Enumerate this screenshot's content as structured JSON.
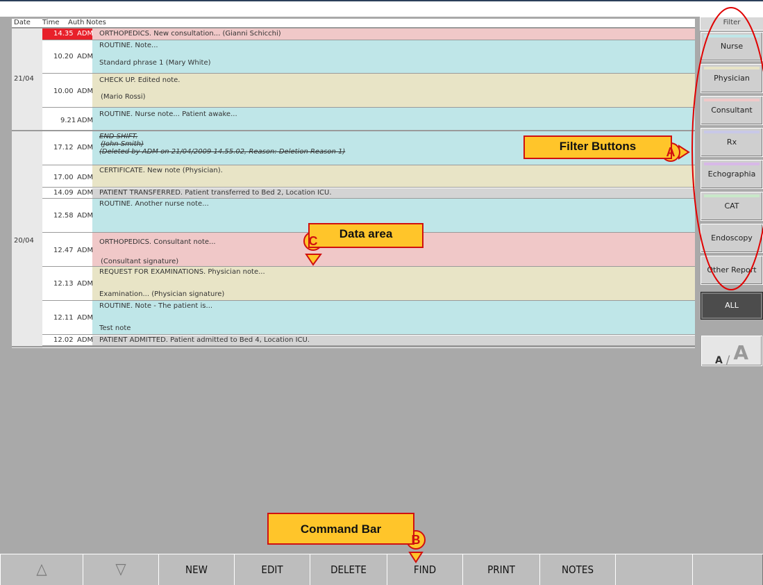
{
  "header": {
    "date": "Date",
    "time": "Time",
    "auth": "Auth",
    "notes": "Notes",
    "filter": "Filter"
  },
  "groups": [
    {
      "date": "21/04"
    },
    {
      "date": "20/04"
    }
  ],
  "rows": [
    {
      "time": "14.35",
      "auth": "ADM",
      "lines": [
        "ORTHOPEDICS. New consultation... (Gianni Schicchi)"
      ]
    },
    {
      "time": "10.20",
      "auth": "ADM",
      "lines": [
        "ROUTINE. Note...",
        "",
        "Standard phrase 1 (Mary White)"
      ]
    },
    {
      "time": "10.00",
      "auth": "ADM",
      "lines": [
        "CHECK UP. Edited note.",
        "",
        "(Mario Rossi)"
      ]
    },
    {
      "time": "9.21",
      "auth": "ADM",
      "lines": [
        "ROUTINE. Nurse note... Patient awake..."
      ]
    },
    {
      "time": "17.12",
      "auth": "ADM",
      "lines": [
        "END SHIFT.",
        "(John Smith)",
        "(Deleted by ADM on 21/04/2009 14.55.02, Reason: Deletion Reason 1)"
      ]
    },
    {
      "time": "17.00",
      "auth": "ADM",
      "lines": [
        "CERTIFICATE. New note (Physician)."
      ]
    },
    {
      "time": "14.09",
      "auth": "ADM",
      "lines": [
        "PATIENT TRANSFERRED. Patient transferred to Bed 2, Location ICU."
      ]
    },
    {
      "time": "12.58",
      "auth": "ADM",
      "lines": [
        "ROUTINE. Another nurse note..."
      ]
    },
    {
      "time": "12.47",
      "auth": "ADM",
      "lines": [
        "ORTHOPEDICS. Consultant note...",
        "",
        "(Consultant signature)"
      ]
    },
    {
      "time": "12.13",
      "auth": "ADM",
      "lines": [
        "REQUEST FOR EXAMINATIONS. Physician note...",
        "",
        "Examination... (Physician signature)"
      ]
    },
    {
      "time": "12.11",
      "auth": "ADM",
      "lines": [
        "ROUTINE. Note - The patient is...",
        "",
        "Test note"
      ]
    },
    {
      "time": "12.02",
      "auth": "ADM",
      "lines": [
        "PATIENT ADMITTED. Patient admitted to Bed 4, Location ICU."
      ]
    }
  ],
  "colors": {
    "nurse": "#bfe6e8",
    "physician": "#e8e4c6",
    "consultant": "#f0c8c8",
    "event": "#d4d4d4",
    "highlight": "#e8202a",
    "rx": "#c8c8e8",
    "echo": "#d8b8e8",
    "cat": "#c8e8c8"
  },
  "filters": [
    "Nurse",
    "Physician",
    "Consultant",
    "Rx",
    "Echographia",
    "CAT",
    "Endoscopy",
    "Other Report"
  ],
  "all_label": "ALL",
  "font_toggle": {
    "small": "A",
    "sep": "/",
    "big": "A"
  },
  "commands": {
    "up": "△",
    "down": "▽",
    "new": "NEW",
    "edit": "EDIT",
    "delete": "DELETE",
    "find": "FIND",
    "print": "PRINT",
    "notes": "NOTES"
  },
  "callouts": {
    "filter": {
      "label": "Filter Buttons",
      "badge": "A"
    },
    "command": {
      "label": "Command Bar",
      "badge": "B"
    },
    "data": {
      "label": "Data area",
      "badge": "C"
    }
  }
}
